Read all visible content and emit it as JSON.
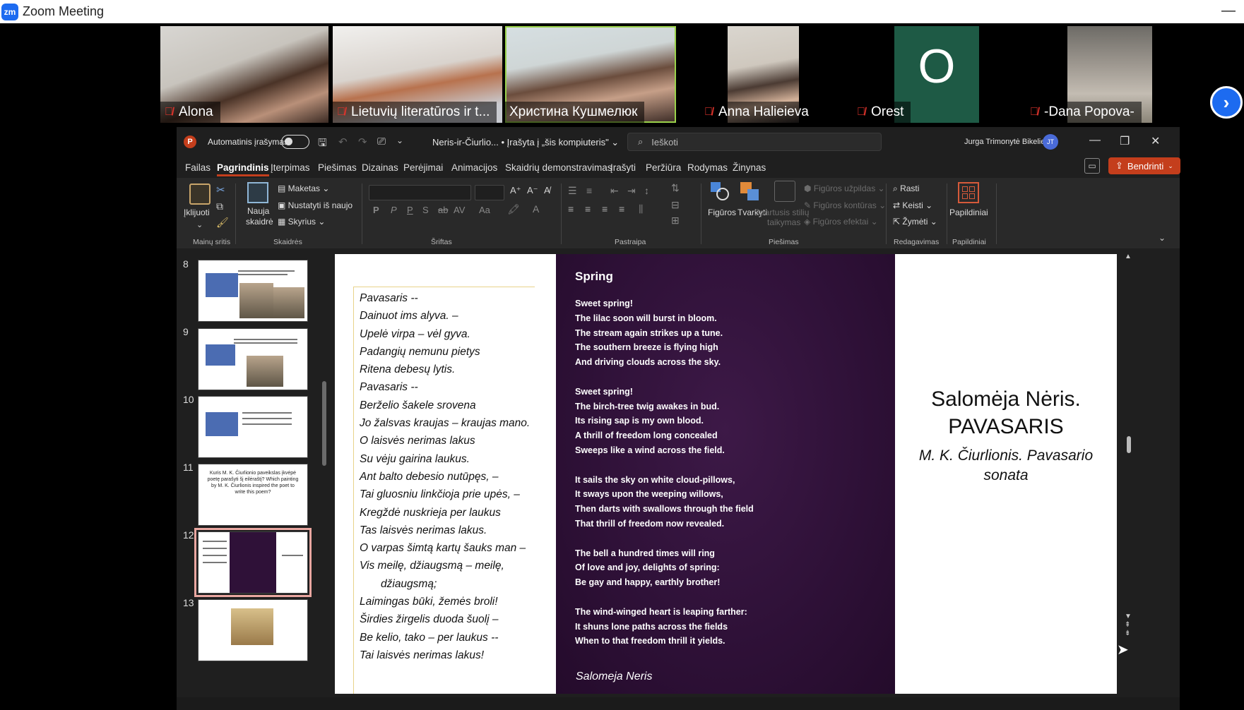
{
  "zoom": {
    "app_title": "Zoom Meeting",
    "logo": "zm",
    "next_page_icon": "chevron-right-icon"
  },
  "participants": [
    {
      "name": "Alona",
      "muted": true,
      "active": false
    },
    {
      "name": "Lietuvių literatūros ir t...",
      "muted": true,
      "active": false
    },
    {
      "name": "Христина Кушмелюк",
      "muted": false,
      "active": true
    },
    {
      "name": "Anna Halieieva",
      "muted": true,
      "active": false
    },
    {
      "name": "Orest",
      "muted": true,
      "active": false,
      "avatar_letter": "O"
    },
    {
      "name": "-Dana Popova-",
      "muted": true,
      "active": false
    }
  ],
  "ppt": {
    "logo": "P",
    "autosave_label": "Automatinis įrašymas",
    "doc_name": "Neris-ir-Čiurlio... • Įrašyta į „šis kompiuteris\" ⌄",
    "search_placeholder": "Ieškoti",
    "user_name": "Jurga Trimonytė Bikelienė",
    "user_initials": "JT",
    "tabs": [
      "Failas",
      "Pagrindinis",
      "Įterpimas",
      "Piešimas",
      "Dizainas",
      "Perėjimai",
      "Animacijos",
      "Skaidrių demonstravimas",
      "Įrašyti",
      "Peržiūra",
      "Rodymas",
      "Žinynas"
    ],
    "share_label": "Bendrinti",
    "ribbon": {
      "paste_label": "Įklijuoti",
      "clipboard_group": "Mainų sritis",
      "new_slide_label_1": "Nauja",
      "new_slide_label_2": "skaidrė",
      "layout_label": "Maketas",
      "reset_label": "Nustatyti iš naujo",
      "section_label": "Skyrius",
      "slides_group": "Skaidrės",
      "font_group": "Šriftas",
      "paragraph_group": "Pastraipa",
      "shapes_label": "Figūros",
      "arrange_label": "Tvarkyti",
      "quick_styles_label_1": "Spartusis stilių",
      "quick_styles_label_2": "taikymas",
      "shape_fill_label": "Figūros užpildas",
      "shape_outline_label": "Figūros kontūras",
      "shape_effects_label": "Figūros efektai",
      "drawing_group": "Piešimas",
      "find_label": "Rasti",
      "replace_label": "Keisti",
      "select_label": "Žymėti",
      "editing_group": "Redagavimas",
      "addins_label": "Papildiniai",
      "addins_group": "Papildiniai"
    },
    "thumbnails": [
      {
        "number": "8"
      },
      {
        "number": "9"
      },
      {
        "number": "10"
      },
      {
        "number": "11",
        "text": "Kuris M. K. Čiurlionio paveikslas įkvėpė poetę parašyti šį eilėraštį? Which painting by M. K. Čiurlionis inspired the poet to write this poem?"
      },
      {
        "number": "12",
        "selected": true
      },
      {
        "number": "13"
      }
    ],
    "slide": {
      "lt_poem": [
        "Pavasaris --",
        "Dainuot ims alyva. –",
        "Upelė virpa – vėl gyva.",
        "Padangių nemunu pietys",
        "Ritena debesų lytis.",
        "Pavasaris --",
        "Berželio šakele srovena",
        "Jo žalsvas kraujas – kraujas mano.",
        "O laisvės nerimas lakus",
        "Su vėju gairina laukus.",
        "Ant balto debesio nutūpęs, –",
        "Tai gluosniu linkčioja prie upės, –",
        "Kregždė nuskrieja per laukus",
        "Tas laisvės nerimas lakus.",
        "O varpas šimtą kartų šauks man –",
        "Vis meilę, džiaugsmą – meilę,",
        "džiaugsmą;",
        "Laimingas būki, žemės broli!",
        "Širdies žirgelis duoda šuolį –",
        "Be kelio, tako – per laukus --",
        "Tai laisvės nerimas lakus!"
      ],
      "en_title": "Spring",
      "en_poem": [
        "Sweet spring!",
        "The lilac soon will burst in bloom.",
        "The stream again strikes up a tune.",
        "The southern breeze is flying high",
        "And driving clouds across the sky.",
        "",
        "Sweet spring!",
        "The birch-tree twig awakes in bud.",
        "Its rising sap is my own blood.",
        "A thrill of freedom long concealed",
        "Sweeps like a wind across the field.",
        "",
        "It sails the sky on white cloud-pillows,",
        "It sways upon the weeping willows,",
        "Then darts with swallows through the field",
        "That thrill of freedom now revealed.",
        "",
        "The bell a hundred times will ring",
        "Of love and joy, delights of spring:",
        "Be gay and happy, earthly brother!",
        "",
        "The wind-winged heart is leaping farther:",
        "It shuns lone paths across the fields",
        "When to that freedom thrill it yields."
      ],
      "en_author": "Salomeja Neris",
      "right_title_1": "Salomėja Nėris.",
      "right_title_2": "PAVASARIS",
      "right_sub_1": "M. K. Čiurlionis. Pavasario",
      "right_sub_2": "sonata"
    }
  }
}
